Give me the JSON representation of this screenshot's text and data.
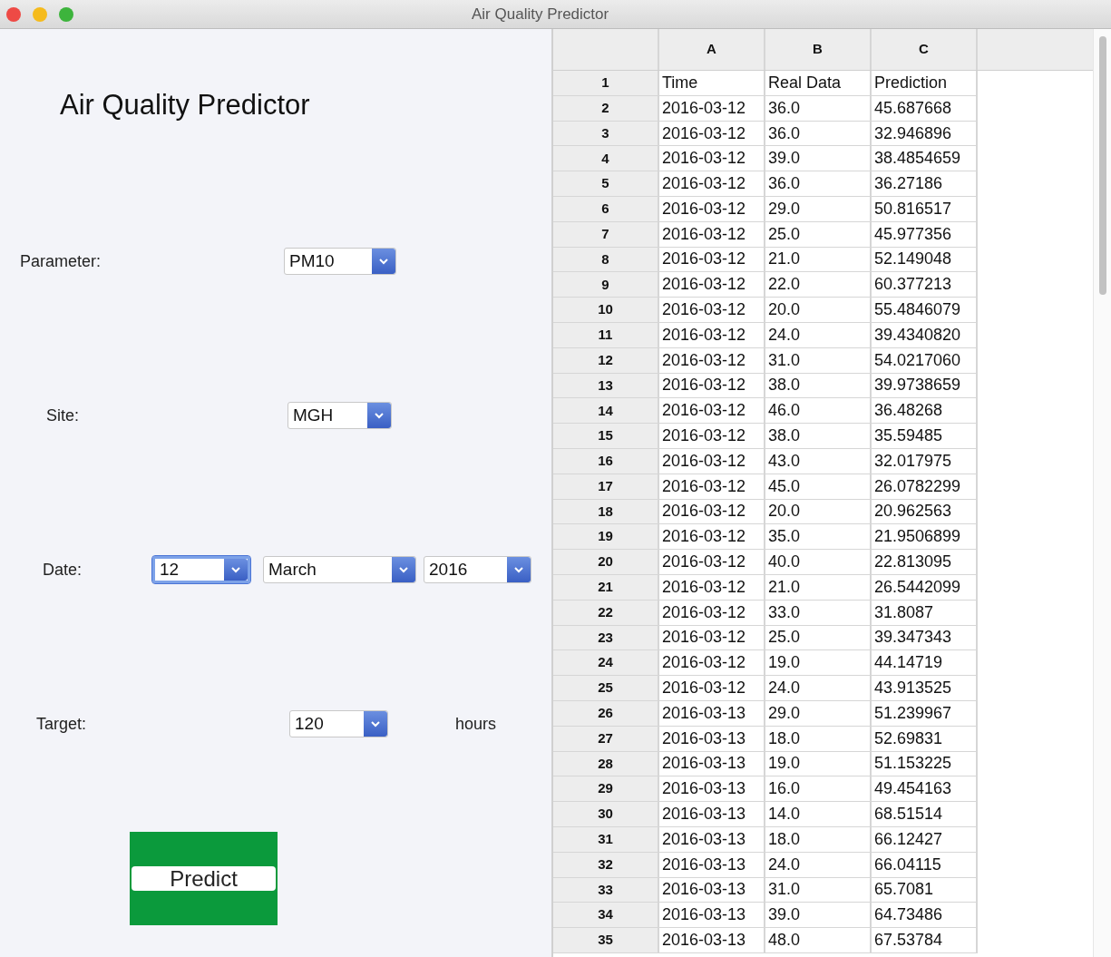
{
  "window": {
    "title": "Air Quality Predictor"
  },
  "form": {
    "heading": "Air Quality Predictor",
    "parameter": {
      "label": "Parameter:",
      "value": "PM10",
      "focused": false
    },
    "site": {
      "label": "Site:",
      "value": "MGH",
      "focused": false
    },
    "date": {
      "label": "Date:",
      "fields": [
        {
          "value": "12",
          "focused": true
        },
        {
          "value": "March",
          "focused": false
        },
        {
          "value": "2016",
          "focused": false
        }
      ]
    },
    "target": {
      "label": "Target:",
      "value": "120",
      "focused": false,
      "unit": "hours"
    },
    "predict_button": "Predict"
  },
  "sheet": {
    "columns": [
      "A",
      "B",
      "C"
    ],
    "rows": [
      {
        "number": "1",
        "cells": [
          "Time",
          "Real Data",
          "Prediction"
        ]
      },
      {
        "number": "2",
        "cells": [
          "2016-03-12",
          "36.0",
          "45.687668"
        ]
      },
      {
        "number": "3",
        "cells": [
          "2016-03-12",
          "36.0",
          "32.946896"
        ]
      },
      {
        "number": "4",
        "cells": [
          "2016-03-12",
          "39.0",
          "38.4854659"
        ]
      },
      {
        "number": "5",
        "cells": [
          "2016-03-12",
          "36.0",
          "36.27186"
        ]
      },
      {
        "number": "6",
        "cells": [
          "2016-03-12",
          "29.0",
          "50.816517"
        ]
      },
      {
        "number": "7",
        "cells": [
          "2016-03-12",
          "25.0",
          "45.977356"
        ]
      },
      {
        "number": "8",
        "cells": [
          "2016-03-12",
          "21.0",
          "52.149048"
        ]
      },
      {
        "number": "9",
        "cells": [
          "2016-03-12",
          "22.0",
          "60.377213"
        ]
      },
      {
        "number": "10",
        "cells": [
          "2016-03-12",
          "20.0",
          "55.4846079"
        ]
      },
      {
        "number": "11",
        "cells": [
          "2016-03-12",
          "24.0",
          "39.4340820"
        ]
      },
      {
        "number": "12",
        "cells": [
          "2016-03-12",
          "31.0",
          "54.0217060"
        ]
      },
      {
        "number": "13",
        "cells": [
          "2016-03-12",
          "38.0",
          "39.9738659"
        ]
      },
      {
        "number": "14",
        "cells": [
          "2016-03-12",
          "46.0",
          "36.48268"
        ]
      },
      {
        "number": "15",
        "cells": [
          "2016-03-12",
          "38.0",
          "35.59485"
        ]
      },
      {
        "number": "16",
        "cells": [
          "2016-03-12",
          "43.0",
          "32.017975"
        ]
      },
      {
        "number": "17",
        "cells": [
          "2016-03-12",
          "45.0",
          "26.0782299"
        ]
      },
      {
        "number": "18",
        "cells": [
          "2016-03-12",
          "20.0",
          "20.962563"
        ]
      },
      {
        "number": "19",
        "cells": [
          "2016-03-12",
          "35.0",
          "21.9506899"
        ]
      },
      {
        "number": "20",
        "cells": [
          "2016-03-12",
          "40.0",
          "22.813095"
        ]
      },
      {
        "number": "21",
        "cells": [
          "2016-03-12",
          "21.0",
          "26.5442099"
        ]
      },
      {
        "number": "22",
        "cells": [
          "2016-03-12",
          "33.0",
          "31.8087"
        ]
      },
      {
        "number": "23",
        "cells": [
          "2016-03-12",
          "25.0",
          "39.347343"
        ]
      },
      {
        "number": "24",
        "cells": [
          "2016-03-12",
          "19.0",
          "44.14719"
        ]
      },
      {
        "number": "25",
        "cells": [
          "2016-03-12",
          "24.0",
          "43.913525"
        ]
      },
      {
        "number": "26",
        "cells": [
          "2016-03-13",
          "29.0",
          "51.239967"
        ]
      },
      {
        "number": "27",
        "cells": [
          "2016-03-13",
          "18.0",
          "52.69831"
        ]
      },
      {
        "number": "28",
        "cells": [
          "2016-03-13",
          "19.0",
          "51.153225"
        ]
      },
      {
        "number": "29",
        "cells": [
          "2016-03-13",
          "16.0",
          "49.454163"
        ]
      },
      {
        "number": "30",
        "cells": [
          "2016-03-13",
          "14.0",
          "68.51514"
        ]
      },
      {
        "number": "31",
        "cells": [
          "2016-03-13",
          "18.0",
          "66.12427"
        ]
      },
      {
        "number": "32",
        "cells": [
          "2016-03-13",
          "24.0",
          "66.04115"
        ]
      },
      {
        "number": "33",
        "cells": [
          "2016-03-13",
          "31.0",
          "65.7081"
        ]
      },
      {
        "number": "34",
        "cells": [
          "2016-03-13",
          "39.0",
          "64.73486"
        ]
      },
      {
        "number": "35",
        "cells": [
          "2016-03-13",
          "48.0",
          "67.53784"
        ]
      }
    ]
  }
}
